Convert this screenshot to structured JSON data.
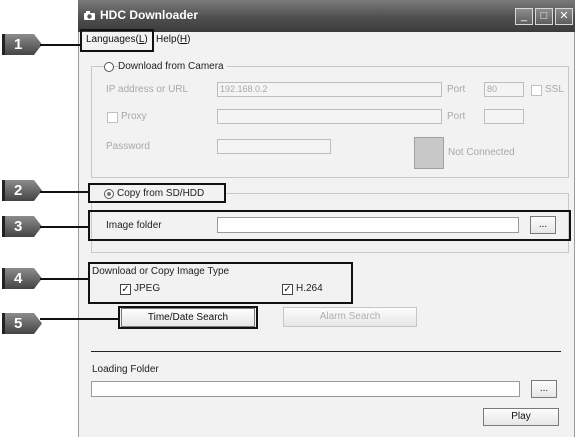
{
  "window": {
    "title": "HDC Downloader",
    "min": "_",
    "max": "□",
    "close": "✕"
  },
  "menu": {
    "languages": {
      "text": "Languages(",
      "key": "L",
      "end": ")"
    },
    "help": {
      "text": "Help(",
      "key": "H",
      "end": ")"
    }
  },
  "camera": {
    "radio_label": "Download from Camera",
    "ip_label": "IP address or URL",
    "ip_value": "192.168.0.2",
    "port_label": "Port",
    "port_value": "80",
    "ssl_label": "SSL",
    "proxy_label": "Proxy",
    "proxy_port_label": "Port",
    "password_label": "Password",
    "status": "Not Connected"
  },
  "copy": {
    "radio_label": "Copy from SD/HDD",
    "folder_label": "Image folder",
    "browse": "..."
  },
  "type": {
    "title": "Download or Copy Image Type",
    "jpeg": "JPEG",
    "h264": "H.264"
  },
  "buttons": {
    "time_search": "Time/Date Search",
    "alarm_search": "Alarm Search",
    "play": "Play"
  },
  "loading": {
    "label": "Loading Folder",
    "browse": "..."
  },
  "callouts": [
    "1",
    "2",
    "3",
    "4",
    "5"
  ]
}
